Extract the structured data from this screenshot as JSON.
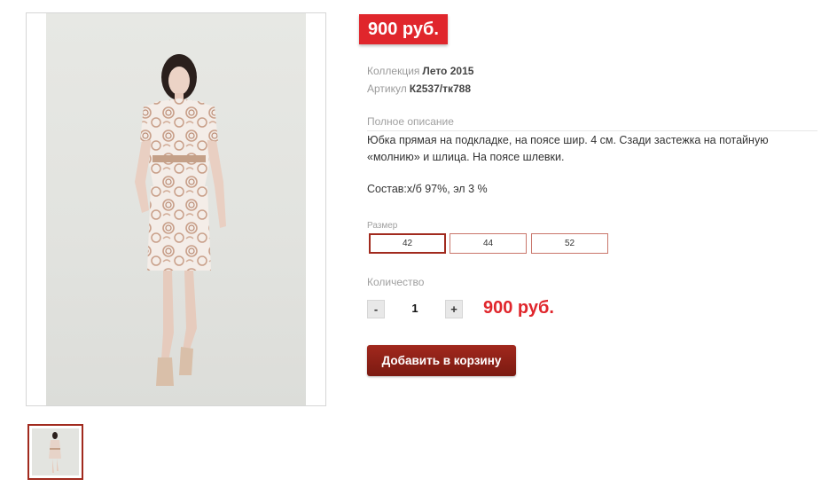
{
  "price_badge": "900 руб.",
  "collection": {
    "label": "Коллекция",
    "value": "Лето 2015"
  },
  "article": {
    "label": "Артикул",
    "value": "К2537/тк788"
  },
  "description": {
    "title": "Полное описание",
    "text": "Юбка прямая на подкладке, на поясе шир. 4 см. Сзади застежка на потайную «молнию» и шлица. На поясе шлевки.",
    "composition": "Состав:х/б 97%, эл 3 %"
  },
  "size": {
    "label": "Размер",
    "options": [
      "42",
      "44",
      "52"
    ],
    "selected": "42"
  },
  "quantity": {
    "label": "Количество",
    "minus": "-",
    "value": "1",
    "plus": "+"
  },
  "total_price": "900 руб.",
  "add_to_cart": "Добавить в корзину",
  "colors": {
    "price_red": "#e0262c",
    "button_dark_red": "#8a1f15",
    "selected_border": "#a12a1e"
  },
  "icons": {
    "product_photo": "product-photo",
    "thumbnail": "thumbnail-photo"
  }
}
